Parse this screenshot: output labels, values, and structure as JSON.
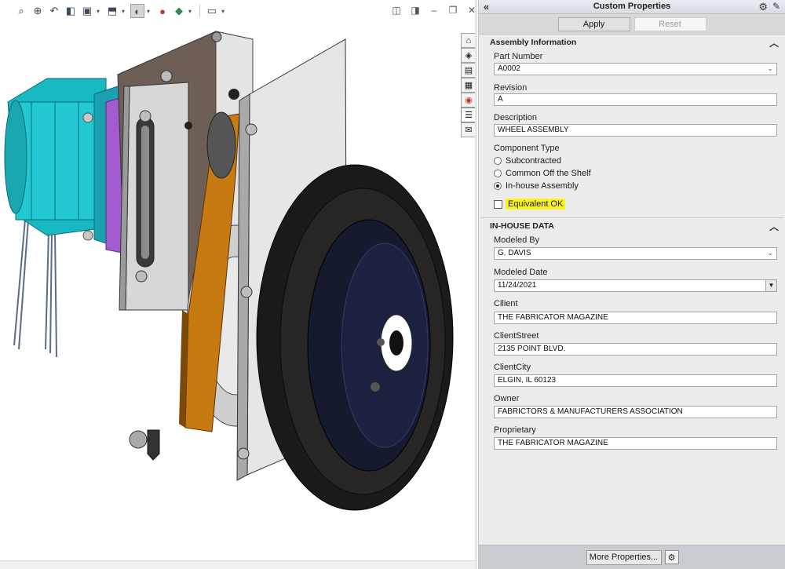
{
  "viewport": {
    "toolbar_icons": [
      "zoom-to-fit-icon",
      "zoom-area-icon",
      "previous-view-icon",
      "section-view-icon",
      "dynamic-annotation-icon",
      "view-orientation-icon",
      "display-style-icon",
      "hide-show-items-icon",
      "edit-appearance-icon",
      "apply-scene-icon",
      "view-settings-icon"
    ],
    "task_tabs": [
      "home-icon",
      "parts-icon",
      "file-explorer-icon",
      "view-palette-icon",
      "appearances-icon",
      "custom-properties-icon",
      "forum-icon"
    ]
  },
  "pane": {
    "title": "Custom Properties",
    "apply_label": "Apply",
    "reset_label": "Reset",
    "assembly": {
      "heading": "Assembly Information",
      "part_number_label": "Part Number",
      "part_number_value": "A0002",
      "revision_label": "Revision",
      "revision_value": "A",
      "description_label": "Description",
      "description_value": "WHEEL ASSEMBLY",
      "component_type_label": "Component Type",
      "options": [
        "Subcontracted",
        "Common Off the Shelf",
        "In-house Assembly"
      ],
      "selected_option": "In-house Assembly",
      "equivalent_label": "Equivalent OK",
      "equivalent_checked": false
    },
    "inhouse": {
      "heading": "IN-HOUSE DATA",
      "modeled_by_label": "Modeled By",
      "modeled_by_value": "G. DAVIS",
      "modeled_date_label": "Modeled Date",
      "modeled_date_value": "11/24/2021",
      "client_label": "Cllient",
      "client_value": "THE FABRICATOR MAGAZINE",
      "client_street_label": "ClientStreet",
      "client_street_value": "2135 POINT BLVD.",
      "client_city_label": "ClientCity",
      "client_city_value": "ELGIN, IL 60123",
      "owner_label": "Owner",
      "owner_value": "FABRICTORS & MANUFACTURERS ASSOCIATION",
      "proprietary_label": "Proprietary",
      "proprietary_value": "THE FABRICATOR MAGAZINE"
    },
    "more_properties_label": "More Properties...",
    "colors": {
      "highlight": "#fbf31a",
      "motor": "#1fc4cf",
      "belt": "#c87a12",
      "tire": "#1a1a1a"
    }
  }
}
